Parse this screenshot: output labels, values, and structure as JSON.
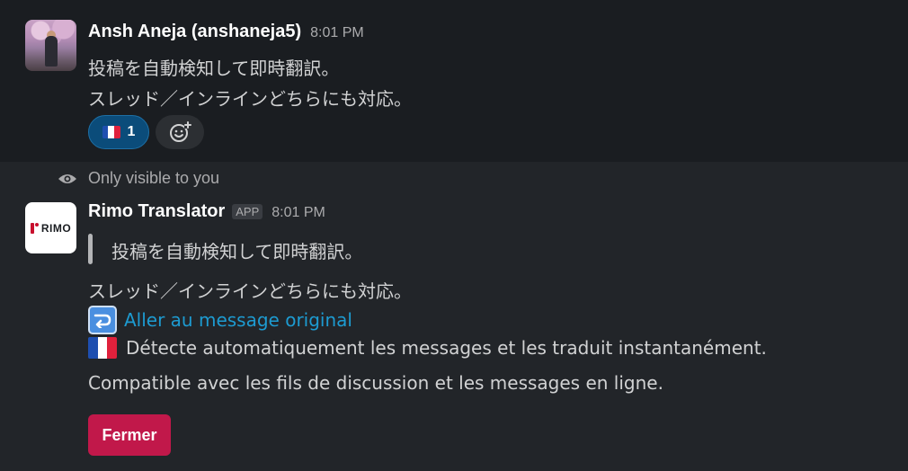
{
  "message1": {
    "sender": "Ansh Aneja (anshaneja5)",
    "time": "8:01 PM",
    "lines": [
      "投稿を自動検知して即時翻訳。",
      "スレッド／インラインどちらにも対応。"
    ],
    "reaction": {
      "emoji": "france-flag",
      "count": "1"
    }
  },
  "message2": {
    "visibility_note": "Only visible to you",
    "sender": "Rimo Translator",
    "badge": "APP",
    "time": "8:01 PM",
    "avatar_text": "RIMO",
    "quote": "投稿を自動検知して即時翻訳。",
    "line2": "スレッド／インラインどちらにも対応。",
    "link_text": "Aller au message original",
    "translation_line1": "Détecte automatiquement les messages et les traduit instantanément.",
    "translation_line2": "Compatible avec les fils de discussion et les messages en ligne.",
    "close_button": "Fermer"
  },
  "colors": {
    "link": "#1d9bd1",
    "button": "#c1184a",
    "reaction_bg": "#0b4c7a"
  }
}
